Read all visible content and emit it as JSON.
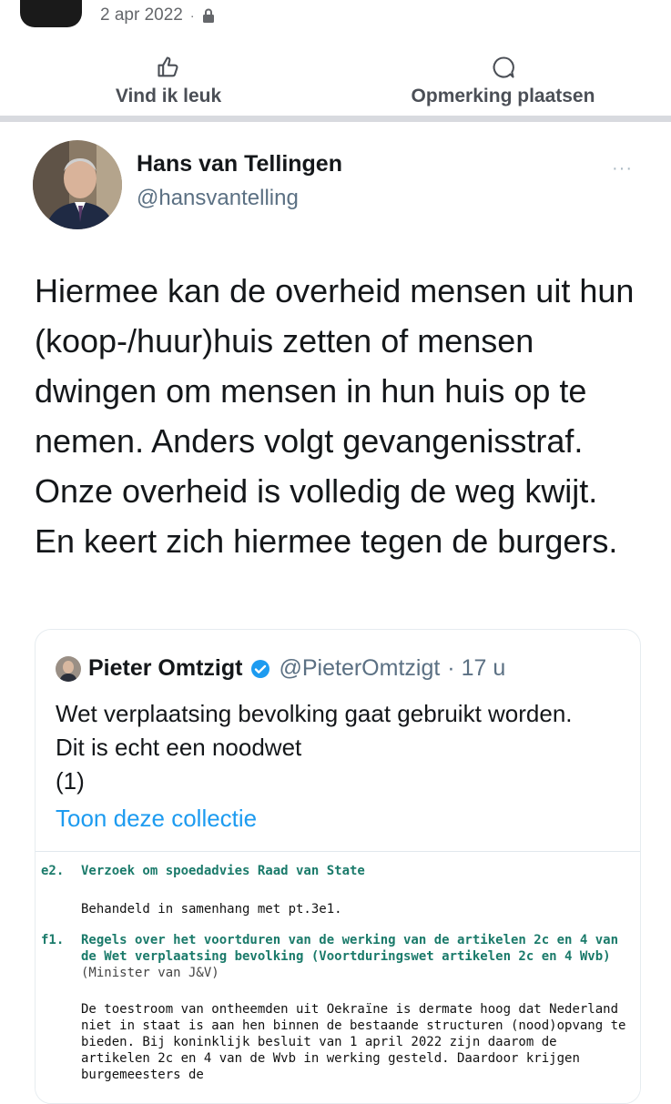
{
  "post_meta": {
    "date": "2 apr 2022",
    "separator": "·"
  },
  "actions": {
    "like_label": "Vind ik leuk",
    "comment_label": "Opmerking plaatsen"
  },
  "tweet": {
    "author_name": "Hans van Tellingen",
    "author_handle": "@hansvantelling",
    "more_label": "···",
    "text": "Hiermee kan de overheid mensen uit hun (koop-/huur)huis zetten of mensen dwingen om mensen in hun huis op te nemen. Anders volgt gevangenisstraf. Onze overheid is volledig de weg kwijt. En keert zich hiermee tegen de burgers."
  },
  "quoted": {
    "author_name": "Pieter Omtzigt",
    "author_handle": "@PieterOmtzigt",
    "time": "· 17 u",
    "text": "Wet verplaatsing bevolking gaat gebruikt worden. Dit is echt een noodwet",
    "count": "(1)",
    "link_label": "Toon deze collectie",
    "document": {
      "e2_num": "e2.",
      "e2_title": "Verzoek om spoedadvies Raad van State",
      "e2_body": "Behandeld in samenhang met pt.3e1.",
      "f1_num": "f1.",
      "f1_title": "Regels over het voortduren van de werking van de artikelen 2c en 4 van de Wet verplaatsing bevolking (Voortduringswet artikelen 2c en 4 Wvb)",
      "f1_minister": "(Minister van J&V)",
      "f1_body": "De toestroom van ontheemden uit Oekraïne is dermate hoog dat Nederland niet in staat is aan hen binnen de bestaande structuren (nood)opvang te bieden. Bij koninklijk besluit van 1 april 2022 zijn daarom de artikelen 2c en 4 van de Wvb in werking gesteld. Daardoor krijgen burgemeesters de"
    }
  },
  "colors": {
    "accent": "#1d9bf0",
    "doc_teal": "#1a7a6a",
    "verified": "#1d9bf0"
  }
}
